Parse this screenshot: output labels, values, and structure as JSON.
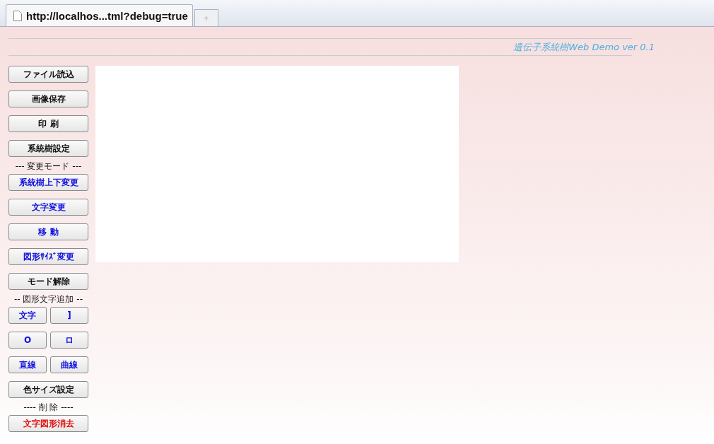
{
  "browser": {
    "tab_title": "http://localhos...tml?debug=true",
    "new_tab": "+"
  },
  "header": {
    "title": "遺伝子系統樹Web Demo ver 0.1"
  },
  "sidebar": [
    {
      "kind": "button",
      "color": "#111111",
      "label": "ファイル読込"
    },
    {
      "kind": "button",
      "color": "#111111",
      "label": "画像保存"
    },
    {
      "kind": "button",
      "color": "#111111",
      "label": "印 刷"
    },
    {
      "kind": "button",
      "color": "#111111",
      "label": "系統樹設定"
    },
    {
      "kind": "heading",
      "label": "--- 変更モード ---"
    },
    {
      "kind": "button",
      "color": "#1010e0",
      "label": "系統樹上下変更"
    },
    {
      "kind": "button",
      "color": "#1010e0",
      "label": "文字変更"
    },
    {
      "kind": "button",
      "color": "#1010e0",
      "label": "移 動"
    },
    {
      "kind": "button",
      "color": "#1010e0",
      "label": "図形ｻｲｽﾞ変更"
    },
    {
      "kind": "button",
      "color": "#111111",
      "label": "モード解除"
    },
    {
      "kind": "heading",
      "label": "-- 図形文字追加 --"
    },
    {
      "kind": "pair",
      "buttons": [
        {
          "color": "#1010e0",
          "label": "文字"
        },
        {
          "color": "#1010e0",
          "label": "]"
        }
      ]
    },
    {
      "kind": "pair",
      "buttons": [
        {
          "color": "#1010e0",
          "label": "O"
        },
        {
          "color": "#1010e0",
          "label": "ロ"
        }
      ]
    },
    {
      "kind": "pair",
      "buttons": [
        {
          "color": "#1010e0",
          "label": "直線"
        },
        {
          "color": "#1010e0",
          "label": "曲線"
        }
      ]
    },
    {
      "kind": "button",
      "color": "#111111",
      "label": "色サイズ設定"
    },
    {
      "kind": "heading",
      "label": "---- 削 除 ----"
    },
    {
      "kind": "button",
      "color": "#e01010",
      "label": "文字図形消去"
    }
  ]
}
